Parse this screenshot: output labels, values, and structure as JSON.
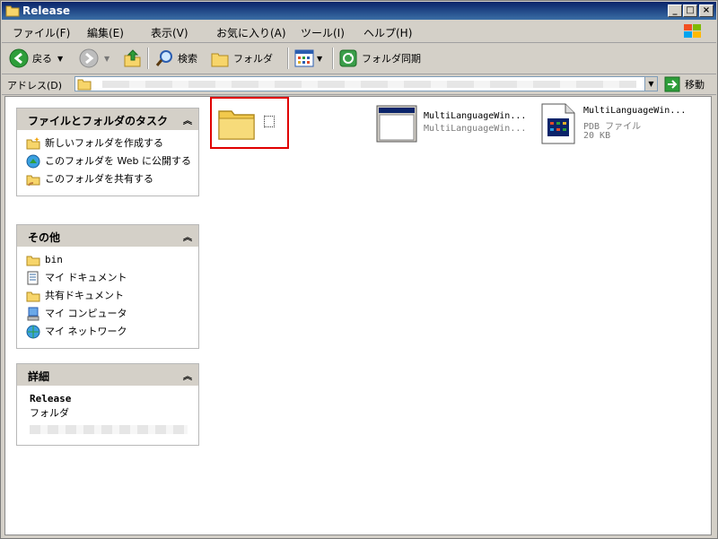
{
  "window": {
    "title": "Release"
  },
  "menu": [
    {
      "label": "ファイル(F)"
    },
    {
      "label": "編集(E)"
    },
    {
      "label": "表示(V)"
    },
    {
      "label": "お気に入り(A)"
    },
    {
      "label": "ツール(I)"
    },
    {
      "label": "ヘルプ(H)"
    }
  ],
  "toolbar": {
    "back_label": "戻る",
    "search_label": "検索",
    "folders_label": "フォルダ",
    "sync_label": "フォルダ同期"
  },
  "address": {
    "label": "アドレス(D)",
    "go_label": "移動"
  },
  "panels": {
    "tasks": {
      "title": "ファイルとフォルダのタスク",
      "items": [
        {
          "label": "新しいフォルダを作成する",
          "icon": "new-folder-icon"
        },
        {
          "label": "このフォルダを Web に公開する",
          "icon": "web-publish-icon"
        },
        {
          "label": "このフォルダを共有する",
          "icon": "share-folder-icon"
        }
      ]
    },
    "other": {
      "title": "その他",
      "items": [
        {
          "label": "bin",
          "icon": "folder-icon"
        },
        {
          "label": "マイ ドキュメント",
          "icon": "documents-icon"
        },
        {
          "label": "共有ドキュメント",
          "icon": "folder-icon"
        },
        {
          "label": "マイ コンピュータ",
          "icon": "computer-icon"
        },
        {
          "label": "マイ ネットワーク",
          "icon": "network-icon"
        }
      ]
    },
    "details": {
      "title": "詳細",
      "name": "Release",
      "type": "フォルダ"
    }
  },
  "files": [
    {
      "name": "",
      "type": "folder"
    },
    {
      "name": "MultiLanguageWin...",
      "sub": "MultiLanguageWin...",
      "type": "exe"
    },
    {
      "name": "MultiLanguageWin...",
      "sub": "PDB ファイル",
      "size": "20 KB",
      "type": "pdb"
    }
  ]
}
